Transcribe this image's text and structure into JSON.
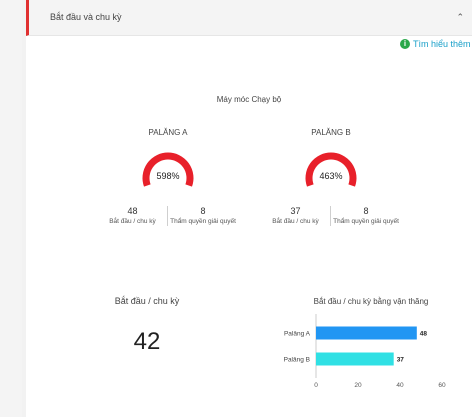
{
  "section": {
    "title": "Bắt đầu và chu kỳ",
    "collapse_icon": "chevron-up-icon"
  },
  "info_link": {
    "label": "Tìm hiểu thêm",
    "icon": "info-icon"
  },
  "group_title": "Máy móc Chạy bộ",
  "hoists": [
    {
      "name": "PALĂNG A",
      "percent_label": "598%",
      "percent": 598,
      "starts_per_cycle": "48",
      "starts_per_cycle_label": "Bắt đầu / chu kỳ",
      "authority_value": "8",
      "authority_label": "Thẩm quyền giải quyết"
    },
    {
      "name": "PALĂNG B",
      "percent_label": "463%",
      "percent": 463,
      "starts_per_cycle": "37",
      "starts_per_cycle_label": "Bắt đầu / chu kỳ",
      "authority_value": "8",
      "authority_label": "Thẩm quyền giải quyết"
    }
  ],
  "kpi": {
    "label": "Bắt đầu / chu kỳ",
    "value": "42"
  },
  "gauge_color": "#e8202a",
  "chart_data": {
    "type": "bar",
    "orientation": "horizontal",
    "title": "Bắt đầu / chu kỳ bằng vận thăng",
    "categories": [
      "Palăng A",
      "Palăng B"
    ],
    "values": [
      48,
      37
    ],
    "colors": [
      "#2196f3",
      "#30e0e4"
    ],
    "xlim": [
      0,
      60
    ],
    "xticks": [
      0,
      20,
      40,
      60
    ],
    "data_labels": true,
    "grid": false
  }
}
